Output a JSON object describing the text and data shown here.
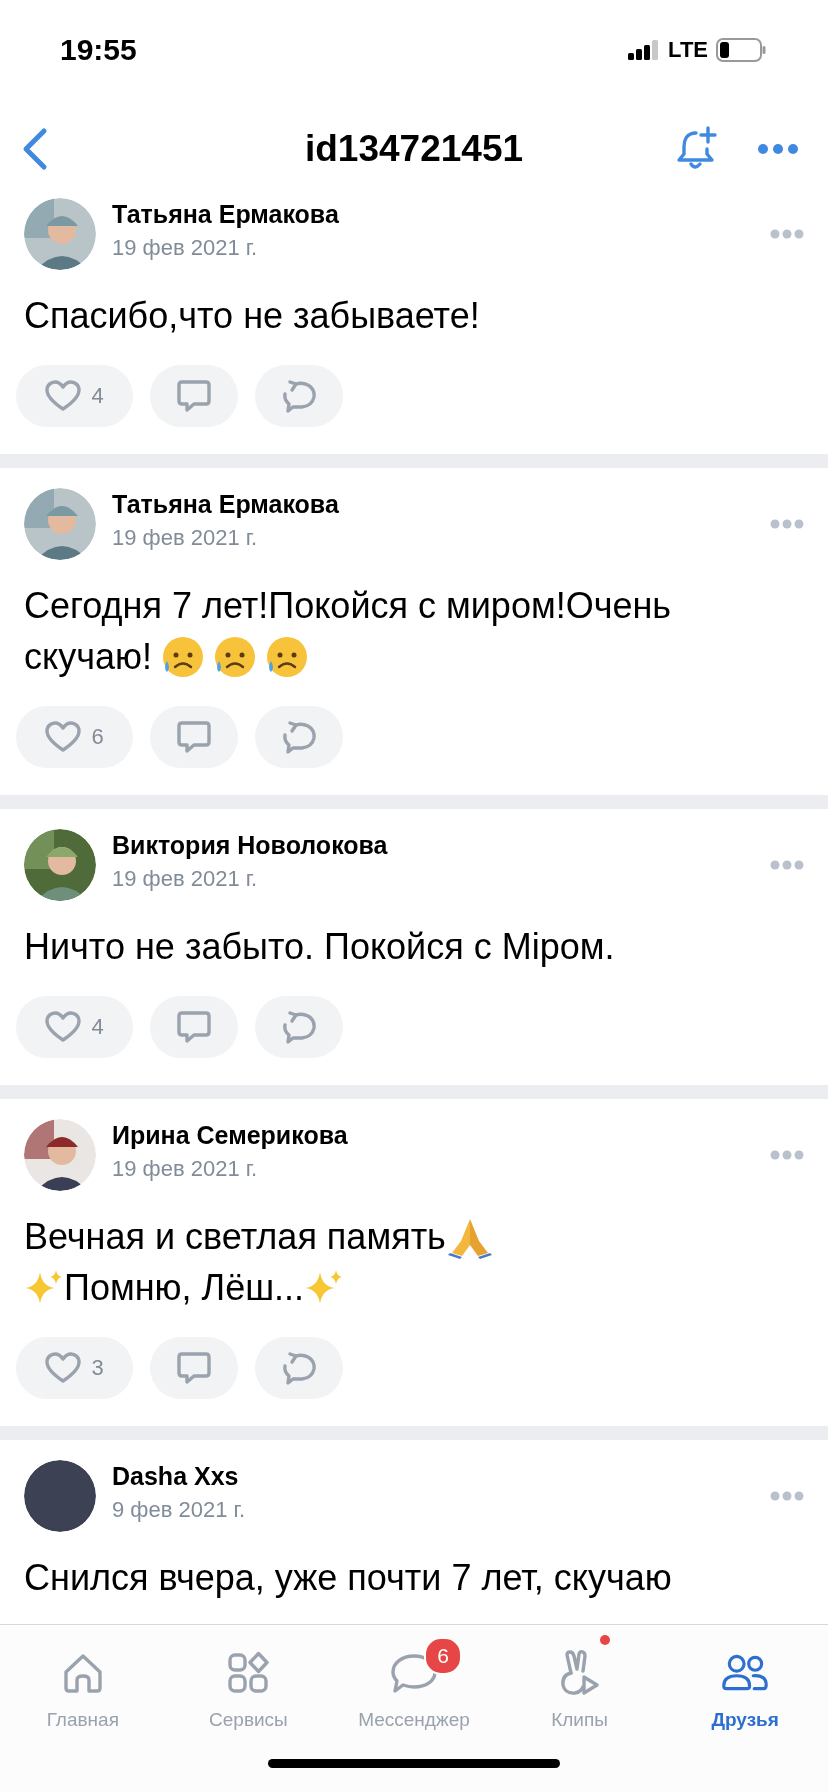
{
  "status_bar": {
    "time": "19:55",
    "network": "LTE"
  },
  "header": {
    "title": "id134721451"
  },
  "posts": [
    {
      "author": "Татьяна Ермакова",
      "date": "19 фев 2021 г.",
      "body": [
        [
          {
            "kind": "text",
            "text": "Спасибо,что не забываете!"
          }
        ]
      ],
      "likes": "4"
    },
    {
      "author": "Татьяна Ермакова",
      "date": "19 фев 2021 г.",
      "body": [
        [
          {
            "kind": "text",
            "text": "Сегодня 7 лет!Покойся с миром!Очень"
          }
        ],
        [
          {
            "kind": "text",
            "text": "скучаю!"
          },
          {
            "kind": "sad-face"
          },
          {
            "kind": "sad-face"
          },
          {
            "kind": "sad-face"
          }
        ]
      ],
      "likes": "6"
    },
    {
      "author": "Виктория Новолокова",
      "date": "19 фев 2021 г.",
      "body": [
        [
          {
            "kind": "text",
            "text": "Ничто не забыто. Покойся с Міром."
          }
        ]
      ],
      "likes": "4"
    },
    {
      "author": "Ирина Семерикова",
      "date": "19 фев 2021 г.",
      "body": [
        [
          {
            "kind": "text",
            "text": "Вечная и светлая память"
          },
          {
            "kind": "praying-hands"
          }
        ],
        [
          {
            "kind": "sparkles"
          },
          {
            "kind": "text",
            "text": "Помню, Лёш..."
          },
          {
            "kind": "sparkles"
          }
        ]
      ],
      "likes": "3"
    },
    {
      "author": "Dasha Xxs",
      "date": "9 фев 2021 г.",
      "body": [
        [
          {
            "kind": "text",
            "text": "Снился вчера, уже почти 7 лет, скучаю"
          }
        ]
      ]
    }
  ],
  "tabs": [
    {
      "kind": "home",
      "label": "Главная",
      "selected": false
    },
    {
      "kind": "services",
      "label": "Сервисы",
      "selected": false
    },
    {
      "kind": "messenger",
      "label": "Мессенджер",
      "selected": false,
      "badge": "6"
    },
    {
      "kind": "clips",
      "label": "Клипы",
      "selected": false,
      "dot": true
    },
    {
      "kind": "friends",
      "label": "Друзья",
      "selected": true
    }
  ]
}
